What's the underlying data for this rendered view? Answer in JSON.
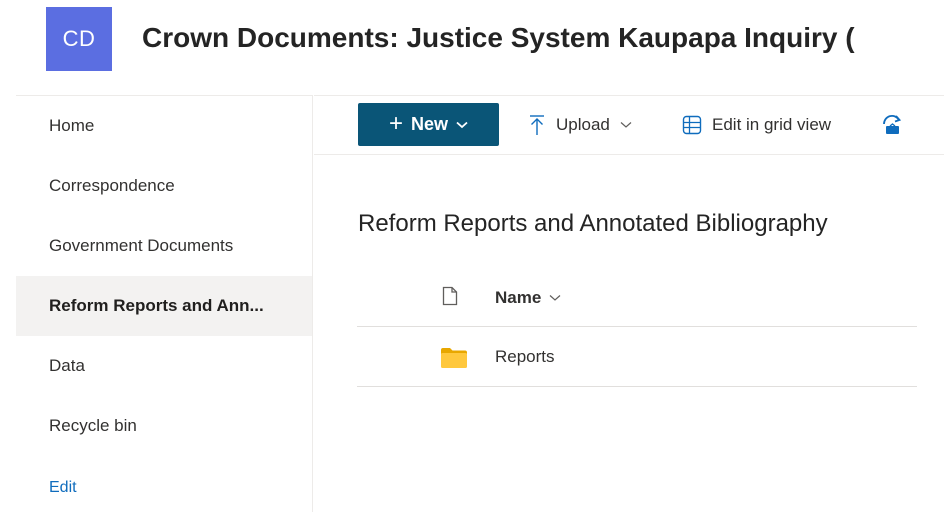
{
  "site": {
    "logo_initials": "CD",
    "logo_color": "#5b6ee1",
    "title": "Crown Documents: Justice System Kaupapa Inquiry ("
  },
  "nav": {
    "items": [
      {
        "label": "Home",
        "selected": false
      },
      {
        "label": "Correspondence",
        "selected": false
      },
      {
        "label": "Government Documents",
        "selected": false
      },
      {
        "label": "Reform Reports and Ann...",
        "selected": true
      },
      {
        "label": "Data",
        "selected": false
      },
      {
        "label": "Recycle bin",
        "selected": false
      }
    ],
    "edit_label": "Edit"
  },
  "commandbar": {
    "new_label": "New",
    "new_color": "#0a5577",
    "upload_label": "Upload",
    "grid_label": "Edit in grid view",
    "sync_icon": "sync-icon",
    "upload_icon": "upload-arrow-icon",
    "grid_icon": "grid-icon"
  },
  "library": {
    "title": "Reform Reports and Annotated Bibliography",
    "columns": {
      "file_type_icon": "file-icon",
      "name_label": "Name"
    },
    "rows": [
      {
        "icon": "folder-icon",
        "name": "Reports"
      }
    ]
  }
}
